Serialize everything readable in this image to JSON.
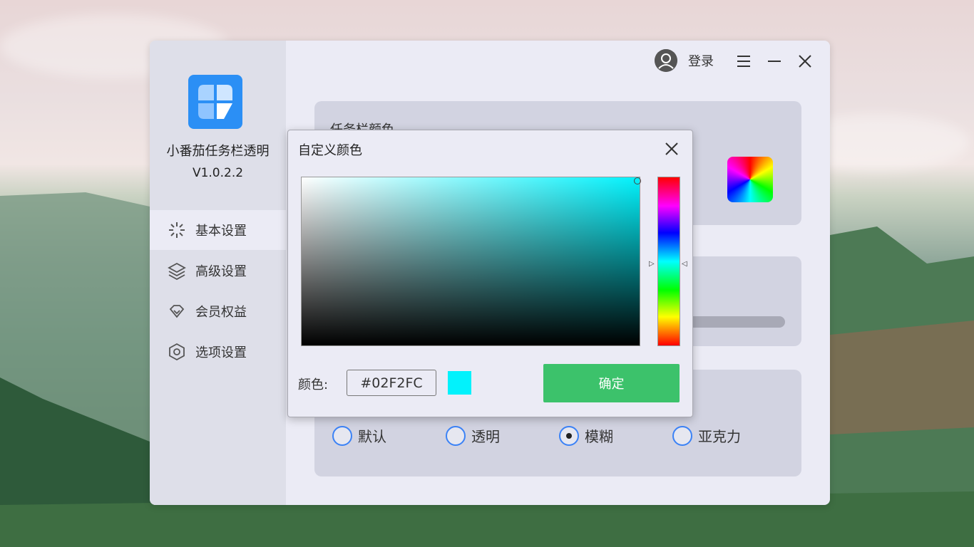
{
  "app": {
    "name": "小番茄任务栏透明",
    "version": "V1.0.2.2"
  },
  "topbar": {
    "login_label": "登录"
  },
  "sidebar": {
    "items": [
      {
        "label": "基本设置",
        "icon": "sparkle-icon",
        "active": true
      },
      {
        "label": "高级设置",
        "icon": "layers-icon",
        "active": false
      },
      {
        "label": "会员权益",
        "icon": "diamond-icon",
        "active": false
      },
      {
        "label": "选项设置",
        "icon": "hexagon-settings-icon",
        "active": false
      }
    ]
  },
  "main": {
    "taskbar_color_title": "任务栏颜色",
    "effects": [
      {
        "label": "默认",
        "checked": false
      },
      {
        "label": "透明",
        "checked": false
      },
      {
        "label": "模糊",
        "checked": true
      },
      {
        "label": "亚克力",
        "checked": false
      }
    ]
  },
  "dialog": {
    "title": "自定义颜色",
    "color_label": "颜色:",
    "hex_value": "#02F2FC",
    "confirm_label": "确定",
    "selected_color": "#02F2FC"
  },
  "colors": {
    "accent_green": "#3cc26b",
    "radio_blue": "#3b82f6",
    "logo_blue": "#2b8ff5"
  }
}
